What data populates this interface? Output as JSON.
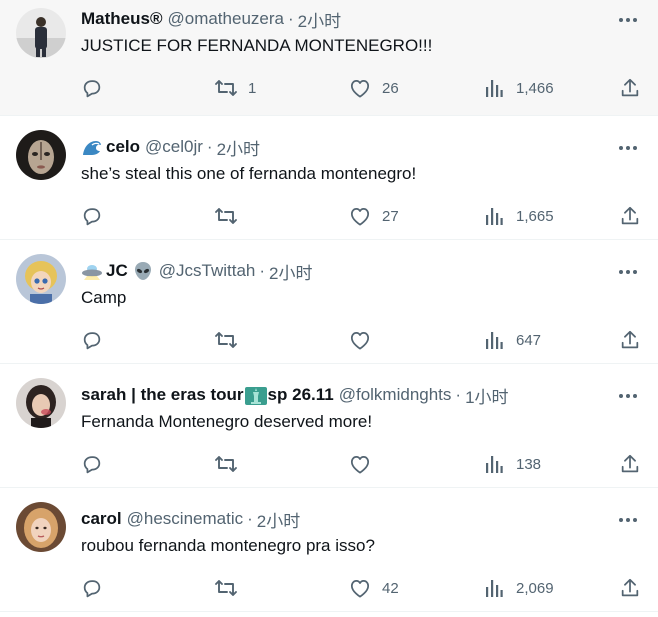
{
  "tweets": [
    {
      "display_name": "Matheus®",
      "handle": "@omatheuzera",
      "time": "2小时",
      "text": "JUSTICE FOR FERNANDA MONTENEGRO!!!",
      "replies": "",
      "retweets": "1",
      "likes": "26",
      "views": "1,466",
      "avatar_color": "#5a6270",
      "prefix_emoji": "",
      "suffix_emoji": ""
    },
    {
      "display_name": "celo",
      "handle": "@cel0jr",
      "time": "2小时",
      "text": "she’s steal this one of fernanda montenegro!",
      "replies": "",
      "retweets": "",
      "likes": "27",
      "views": "1,665",
      "avatar_color": "#3b3530",
      "prefix_emoji": "wave-icon",
      "suffix_emoji": ""
    },
    {
      "display_name": "JC",
      "handle": "@JcsTwittah",
      "time": "2小时",
      "text": "Camp",
      "replies": "",
      "retweets": "",
      "likes": "",
      "views": "647",
      "avatar_color": "#d9c27a",
      "prefix_emoji": "ufo-icon",
      "suffix_emoji": "alien-icon"
    },
    {
      "display_name": "sarah | the eras tour",
      "display_name_suffix": "sp 26.11",
      "handle": "@folkmidnghts",
      "time": "1小时",
      "text": "Fernanda Montenegro deserved more!",
      "replies": "",
      "retweets": "",
      "likes": "",
      "views": "138",
      "avatar_color": "#4a3c3a",
      "prefix_emoji": "",
      "suffix_emoji": "statue-of-liberty-icon"
    },
    {
      "display_name": "carol",
      "handle": "@hescinematic",
      "time": "2小时",
      "text": "roubou fernanda montenegro pra isso?",
      "replies": "",
      "retweets": "",
      "likes": "42",
      "views": "2,069",
      "avatar_color": "#c99a6a",
      "prefix_emoji": "",
      "suffix_emoji": ""
    }
  ],
  "separator": "·",
  "colors": {
    "text_primary": "#0f1419",
    "text_secondary": "#536471",
    "divider": "#eff3f4",
    "hover_background": "#f7f7f7"
  }
}
